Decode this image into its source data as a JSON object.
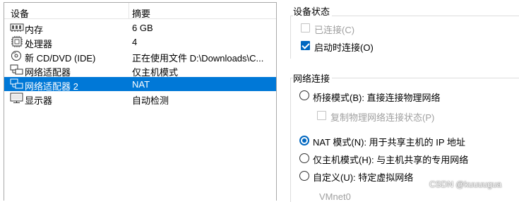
{
  "list": {
    "headers": {
      "device": "设备",
      "summary": "摘要"
    },
    "rows": [
      {
        "name": "内存",
        "summary": "6 GB",
        "icon": "memory-icon"
      },
      {
        "name": "处理器",
        "summary": "4",
        "icon": "processor-icon"
      },
      {
        "name": "新 CD/DVD (IDE)",
        "summary": "正在使用文件 D:\\Downloads\\C...",
        "icon": "cd-dvd-icon"
      },
      {
        "name": "网络适配器",
        "summary": "仅主机模式",
        "icon": "network-adapter-icon"
      },
      {
        "name": "网络适配器 2",
        "summary": "NAT",
        "icon": "network-adapter-icon",
        "selected": true
      },
      {
        "name": "显示器",
        "summary": "自动检测",
        "icon": "display-icon"
      }
    ]
  },
  "device_status": {
    "title": "设备状态",
    "connected": "已连接(C)",
    "connect_on_power_on": "启动时连接(O)"
  },
  "network_connection": {
    "title": "网络连接",
    "bridged": "桥接模式(B): 直接连接物理网络",
    "replicate": "复制物理网络连接状态(P)",
    "nat": "NAT 模式(N): 用于共享主机的 IP 地址",
    "host_only": "仅主机模式(H): 与主机共享的专用网络",
    "custom": "自定义(U): 特定虚拟网络",
    "vmnet": "VMnet0"
  },
  "watermark": "CSDN @kuuuugua",
  "colors": {
    "selection": "#0078d7",
    "accent": "#0067c0"
  }
}
